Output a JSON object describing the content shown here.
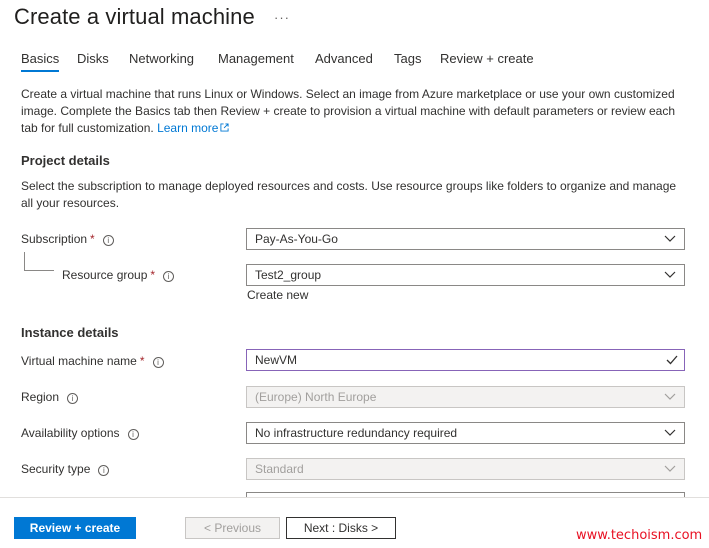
{
  "header": {
    "title": "Create a virtual machine",
    "more_label": "···"
  },
  "tabs": [
    {
      "label": "Basics"
    },
    {
      "label": "Disks"
    },
    {
      "label": "Networking"
    },
    {
      "label": "Management"
    },
    {
      "label": "Advanced"
    },
    {
      "label": "Tags"
    },
    {
      "label": "Review + create"
    }
  ],
  "intro": {
    "text": "Create a virtual machine that runs Linux or Windows. Select an image from Azure marketplace or use your own customized image. Complete the Basics tab then Review + create to provision a virtual machine with default parameters or review each tab for full customization.",
    "learn_more": "Learn more"
  },
  "project_details": {
    "title": "Project details",
    "description": "Select the subscription to manage deployed resources and costs. Use resource groups like folders to organize and manage all your resources.",
    "subscription": {
      "label": "Subscription",
      "value": "Pay-As-You-Go"
    },
    "resource_group": {
      "label": "Resource group",
      "value": "Test2_group",
      "create_new": "Create new"
    }
  },
  "instance_details": {
    "title": "Instance details",
    "vm_name": {
      "label": "Virtual machine name",
      "value": "NewVM"
    },
    "region": {
      "label": "Region",
      "value": "(Europe) North Europe"
    },
    "availability": {
      "label": "Availability options",
      "value": "No infrastructure redundancy required"
    },
    "security_type": {
      "label": "Security type",
      "value": "Standard"
    }
  },
  "footer": {
    "review_create": "Review + create",
    "previous": "< Previous",
    "next": "Next : Disks >",
    "watermark": "www.techoism.com"
  },
  "colors": {
    "accent": "#0078d4",
    "required": "#a4262c",
    "focus": "#8764b8",
    "watermark": "#e81123"
  },
  "required_marker": "*",
  "info_glyph": "i"
}
